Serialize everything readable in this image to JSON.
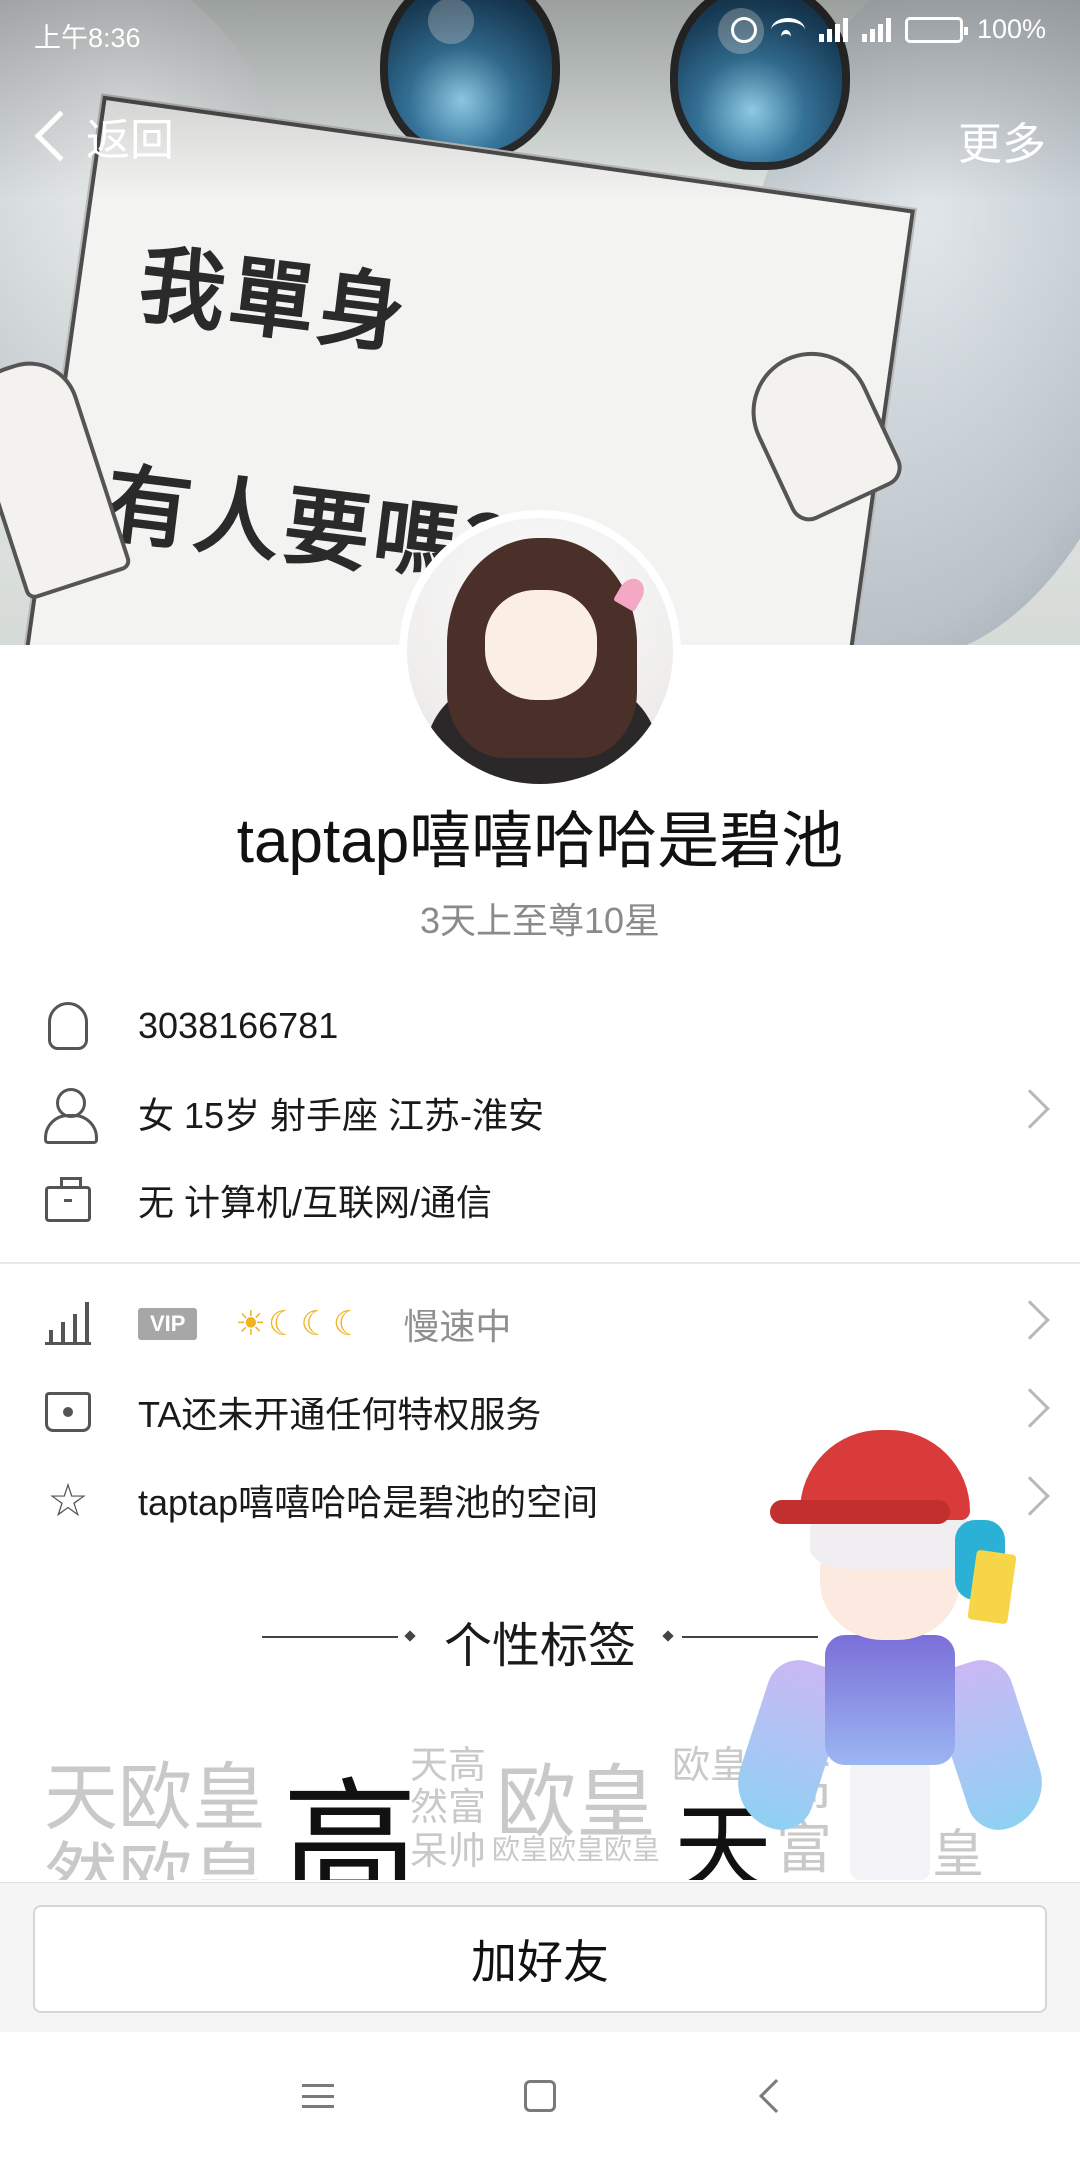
{
  "status_bar": {
    "time": "上午8:36",
    "battery": "100%",
    "icons": [
      "alarm-icon",
      "wifi-icon",
      "signal-icon",
      "signal-icon",
      "battery-icon"
    ]
  },
  "nav": {
    "back_label": "返回",
    "more_label": "更多"
  },
  "cover": {
    "sign_line1": "我單身",
    "sign_line2": "有人要嗎？"
  },
  "profile": {
    "name": "taptap嘻嘻哈哈是碧池",
    "subtitle": "3天上至尊10星"
  },
  "info": {
    "qq_number": "3038166781",
    "basic": "女  15岁  射手座  江苏-淮安",
    "work": "无 计算机/互联网/通信"
  },
  "services": {
    "vip_badge": "VIP",
    "level_icons": "☀☾☾☾",
    "speed_status": "慢速中",
    "privilege": "TA还未开通任何特权服务",
    "space": "taptap嘻嘻哈哈是碧池的空间"
  },
  "tags": {
    "title": "个性标签",
    "cloud": [
      "天欧皇",
      "然欧皇",
      "高",
      "天高",
      "然富",
      "呆帅",
      "欧皇欧皇欧皇",
      "欧皇",
      "欧皇",
      "天",
      "富",
      "高",
      "欧皇"
    ]
  },
  "actions": {
    "add_friend": "加好友"
  },
  "colors": {
    "accent_text": "#111111",
    "secondary_text": "#8a8a8a",
    "vip_badge_bg": "#a7a7a7",
    "level_icon": "#f2b21d"
  }
}
